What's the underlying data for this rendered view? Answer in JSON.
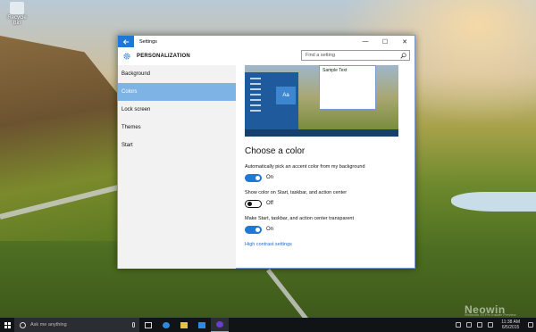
{
  "desktop": {
    "recycle_bin_label": "Recycle Bin",
    "watermark": "Neowin",
    "watermark_sub": "Windows 10 Pro Insider Preview"
  },
  "window": {
    "title": "Settings",
    "minimize_glyph": "—",
    "maximize_glyph": "☐",
    "close_glyph": "✕"
  },
  "header": {
    "title": "PERSONALIZATION",
    "icon": "gear-icon"
  },
  "search": {
    "placeholder": "Find a setting",
    "icon": "search-icon"
  },
  "sidebar": {
    "items": [
      {
        "label": "Background",
        "active": false
      },
      {
        "label": "Colors",
        "active": true
      },
      {
        "label": "Lock screen",
        "active": false
      },
      {
        "label": "Themes",
        "active": false
      },
      {
        "label": "Start",
        "active": false
      }
    ]
  },
  "preview": {
    "tile_label": "Aa",
    "sample_text": "Sample Text"
  },
  "content": {
    "section_title": "Choose a color",
    "options": [
      {
        "label": "Automatically pick an accent color from my background",
        "state": "On",
        "on": true
      },
      {
        "label": "Show color on Start, taskbar, and action center",
        "state": "Off",
        "on": false
      },
      {
        "label": "Make Start, taskbar, and action center transparent",
        "state": "On",
        "on": true
      }
    ],
    "link": "High contrast settings"
  },
  "taskbar": {
    "search_placeholder": "Ask me anything",
    "time": "11:38 AM",
    "date": "6/5/2015"
  },
  "colors": {
    "accent": "#1e78d6",
    "selected_nav": "#7eb3e6",
    "link": "#1e6fc8",
    "taskbar": "#111417"
  }
}
